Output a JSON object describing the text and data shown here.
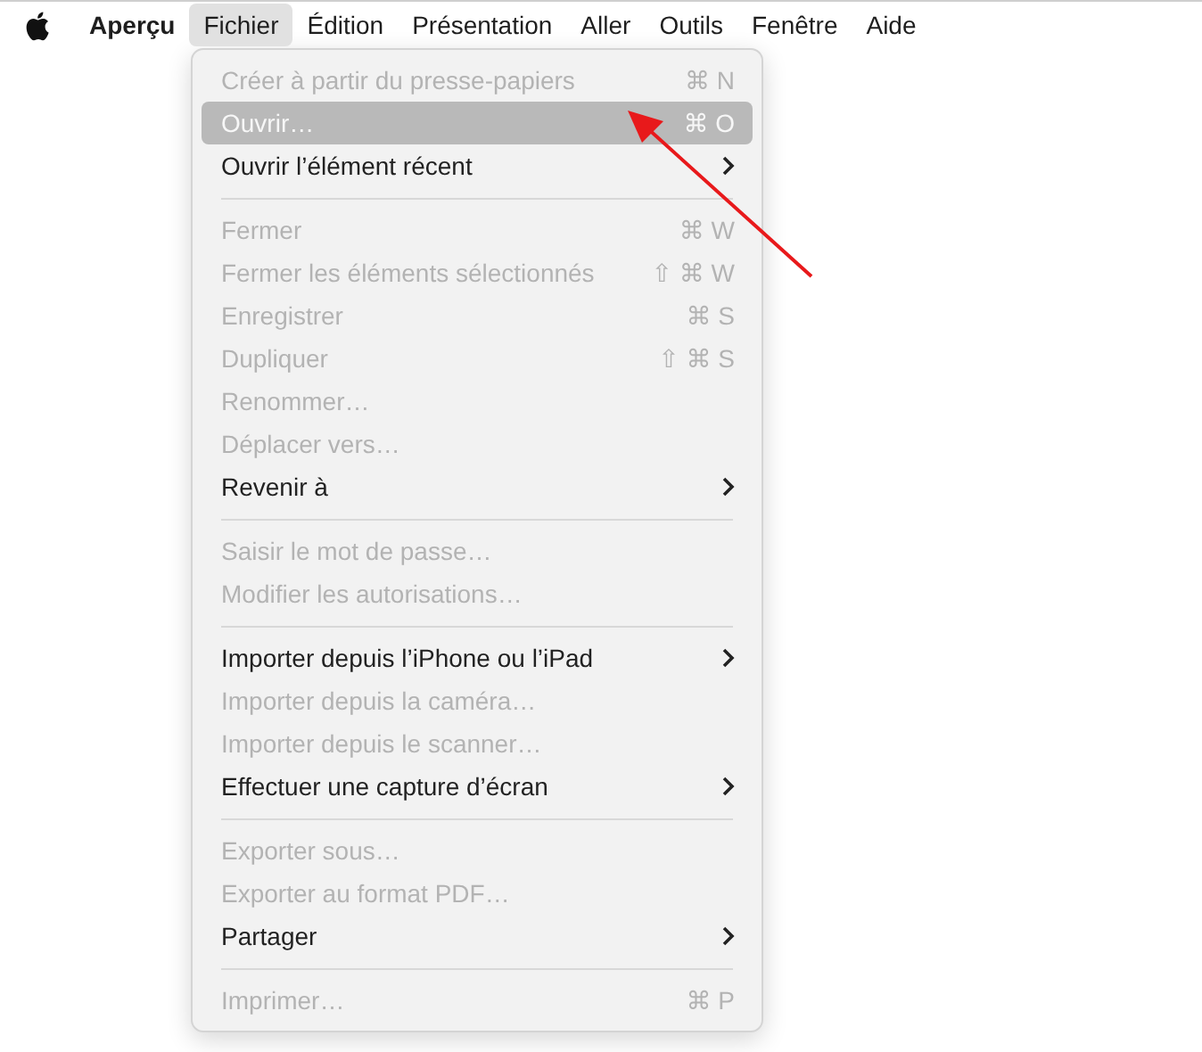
{
  "menu_bar": {
    "items": [
      {
        "kind": "apple"
      },
      {
        "kind": "app",
        "label": "Aperçu",
        "selected": false
      },
      {
        "kind": "menu",
        "label": "Fichier",
        "selected": true
      },
      {
        "kind": "menu",
        "label": "Édition",
        "selected": false
      },
      {
        "kind": "menu",
        "label": "Présentation",
        "selected": false
      },
      {
        "kind": "menu",
        "label": "Aller",
        "selected": false
      },
      {
        "kind": "menu",
        "label": "Outils",
        "selected": false
      },
      {
        "kind": "menu",
        "label": "Fenêtre",
        "selected": false
      },
      {
        "kind": "menu",
        "label": "Aide",
        "selected": false
      }
    ]
  },
  "file_menu": {
    "items": [
      {
        "kind": "item",
        "label": "Créer à partir du presse-papiers",
        "shortcut": "⌘ N",
        "disabled": true,
        "selected": false,
        "submenu": false
      },
      {
        "kind": "item",
        "label": "Ouvrir…",
        "shortcut": "⌘ O",
        "disabled": false,
        "selected": true,
        "submenu": false
      },
      {
        "kind": "item",
        "label": "Ouvrir l’élément récent",
        "disabled": false,
        "selected": false,
        "submenu": true
      },
      {
        "kind": "separator"
      },
      {
        "kind": "item",
        "label": "Fermer",
        "shortcut": "⌘ W",
        "disabled": true,
        "selected": false,
        "submenu": false
      },
      {
        "kind": "item",
        "label": "Fermer les éléments sélectionnés",
        "shortcut": "⇧ ⌘ W",
        "disabled": true,
        "selected": false,
        "submenu": false
      },
      {
        "kind": "item",
        "label": "Enregistrer",
        "shortcut": "⌘ S",
        "disabled": true,
        "selected": false,
        "submenu": false
      },
      {
        "kind": "item",
        "label": "Dupliquer",
        "shortcut": "⇧ ⌘ S",
        "disabled": true,
        "selected": false,
        "submenu": false
      },
      {
        "kind": "item",
        "label": "Renommer…",
        "disabled": true,
        "selected": false,
        "submenu": false
      },
      {
        "kind": "item",
        "label": "Déplacer vers…",
        "disabled": true,
        "selected": false,
        "submenu": false
      },
      {
        "kind": "item",
        "label": "Revenir à",
        "disabled": false,
        "selected": false,
        "submenu": true
      },
      {
        "kind": "separator"
      },
      {
        "kind": "item",
        "label": "Saisir le mot de passe…",
        "disabled": true,
        "selected": false,
        "submenu": false
      },
      {
        "kind": "item",
        "label": "Modifier les autorisations…",
        "disabled": true,
        "selected": false,
        "submenu": false
      },
      {
        "kind": "separator"
      },
      {
        "kind": "item",
        "label": "Importer depuis l’iPhone ou l’iPad",
        "disabled": false,
        "selected": false,
        "submenu": true
      },
      {
        "kind": "item",
        "label": "Importer depuis la caméra…",
        "disabled": true,
        "selected": false,
        "submenu": false
      },
      {
        "kind": "item",
        "label": "Importer depuis le scanner…",
        "disabled": true,
        "selected": false,
        "submenu": false
      },
      {
        "kind": "item",
        "label": "Effectuer une capture d’écran",
        "disabled": false,
        "selected": false,
        "submenu": true
      },
      {
        "kind": "separator"
      },
      {
        "kind": "item",
        "label": "Exporter sous…",
        "disabled": true,
        "selected": false,
        "submenu": false
      },
      {
        "kind": "item",
        "label": "Exporter au format PDF…",
        "disabled": true,
        "selected": false,
        "submenu": false
      },
      {
        "kind": "item",
        "label": "Partager",
        "disabled": false,
        "selected": false,
        "submenu": true
      },
      {
        "kind": "separator"
      },
      {
        "kind": "item",
        "label": "Imprimer…",
        "shortcut": "⌘ P",
        "disabled": true,
        "selected": false,
        "submenu": false
      }
    ]
  }
}
